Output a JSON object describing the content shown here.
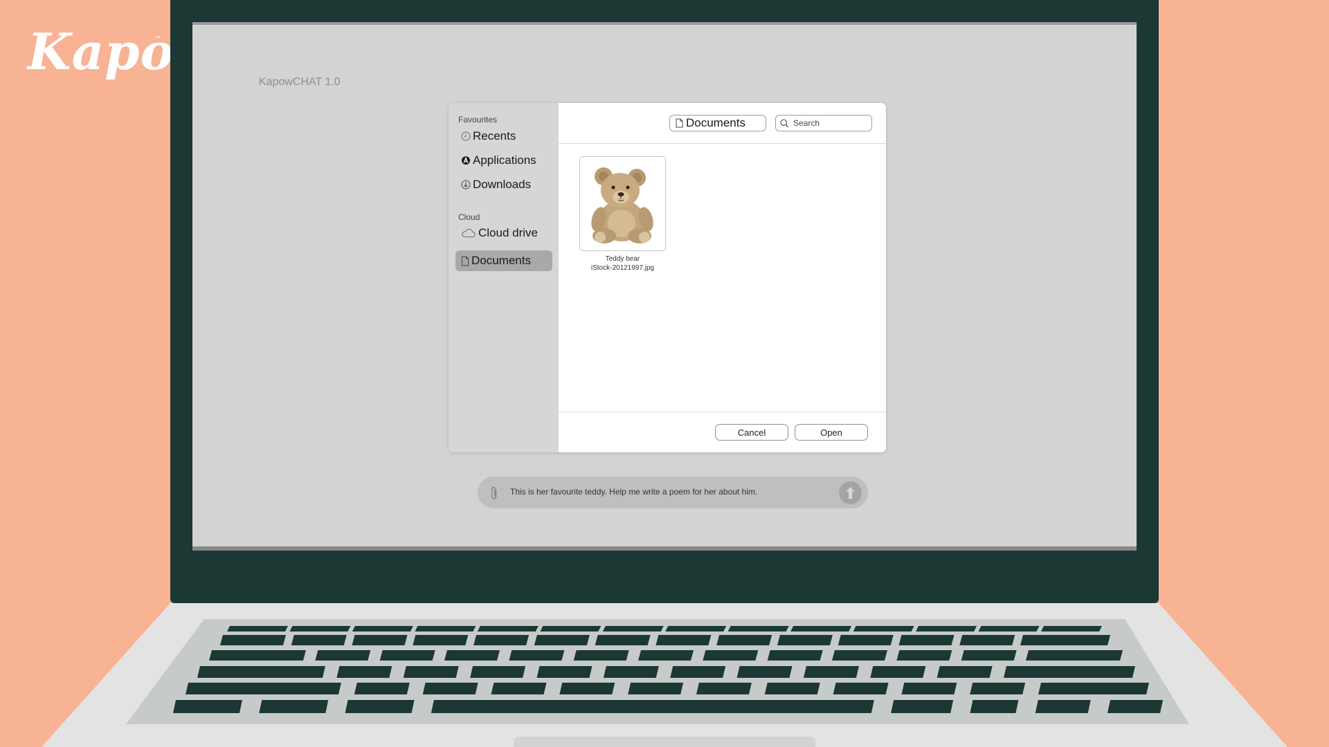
{
  "brand": {
    "logo_text": "Kapow",
    "trademark": "™"
  },
  "app": {
    "title": "KapowCHAT 1.0"
  },
  "dialog": {
    "sidebar": {
      "sections": [
        {
          "label": "Favourites",
          "items": [
            {
              "label": "Recents",
              "icon": "clock-icon"
            },
            {
              "label": "Applications",
              "icon": "applications-icon"
            },
            {
              "label": "Downloads",
              "icon": "download-icon"
            }
          ]
        },
        {
          "label": "Cloud",
          "items": [
            {
              "label": "Cloud drive",
              "icon": "cloud-icon"
            },
            {
              "label": "Documents",
              "icon": "document-icon",
              "selected": true
            }
          ]
        }
      ]
    },
    "toolbar": {
      "current_folder": "Documents",
      "search_placeholder": "Search"
    },
    "files": [
      {
        "name_line1": "Teddy bear",
        "name_line2": "iStock-20121997.jpg",
        "thumbnail": "teddy-bear-image"
      }
    ],
    "buttons": {
      "cancel": "Cancel",
      "open": "Open"
    }
  },
  "chat": {
    "message": "This is her favourite teddy. Help me write a poem for her about him.",
    "attach_icon": "paperclip-icon",
    "send_icon": "arrow-up-icon"
  },
  "colors": {
    "background": "#f7b394",
    "laptop_body": "#1c3834",
    "screen": "#d3d3d3",
    "keyboard_deck": "#e3e3e3",
    "keys": "#1c3834"
  }
}
